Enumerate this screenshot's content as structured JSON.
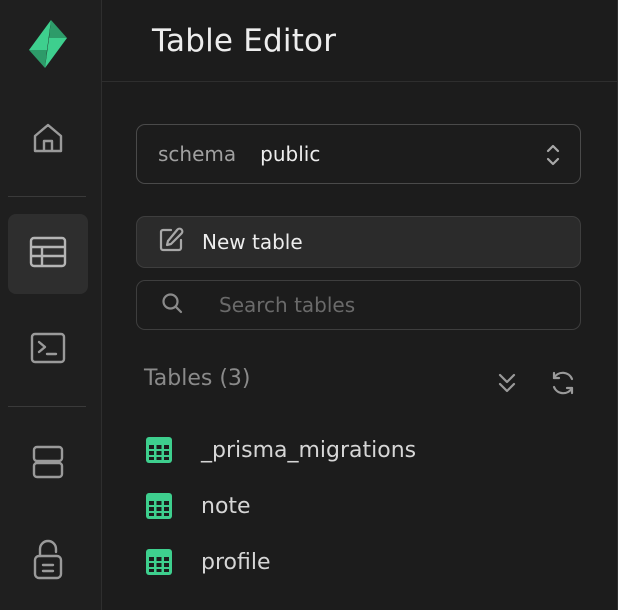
{
  "header": {
    "title": "Table Editor"
  },
  "schema": {
    "label": "schema",
    "value": "public"
  },
  "actions": {
    "new_table_label": "New table"
  },
  "search": {
    "placeholder": "Search tables",
    "value": ""
  },
  "tables": {
    "heading": "Tables (3)",
    "items": [
      {
        "name": "_prisma_migrations"
      },
      {
        "name": "note"
      },
      {
        "name": "profile"
      }
    ]
  },
  "colors": {
    "brand": "#3ecf8e",
    "table_icon": "#3ecf8e",
    "background": "#1c1c1c"
  },
  "icons": {
    "rail": [
      "logo-icon",
      "home-icon",
      "table-editor-icon",
      "sql-editor-icon",
      "database-icon",
      "auth-lock-icon"
    ]
  }
}
